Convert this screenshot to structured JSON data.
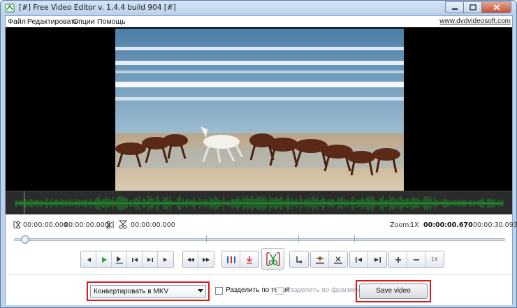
{
  "window": {
    "title": "[#] Free Video Editor v. 1.4.4 build 904 [#]"
  },
  "menu": {
    "items": [
      "Файл",
      "Редактировать",
      "Опции",
      "Помощь"
    ],
    "website": "www.dvdvideosoft.com"
  },
  "timeline": {
    "start_time": "00:00:00.000",
    "end_time": "00:00:00.000",
    "cut_time": "00:00:00.000",
    "zoom_label": "Zoom:",
    "zoom_value": "1X",
    "current_time": "00:00:00.670",
    "separator": "/",
    "total_time": "00:00:30.093"
  },
  "toolbar": {
    "zoom_level": "1X"
  },
  "bottom": {
    "format_select": "Конвертировать в MKV",
    "split_by_tags_label": "Разделить по тегам",
    "split_by_tags_checked": false,
    "split_by_fragments_label": "Разделить по фрагментам",
    "split_by_fragments_checked": false,
    "split_by_fragments_enabled": false,
    "save_button": "Save video"
  },
  "colors": {
    "waveform": "#1e8a2a",
    "highlight": "#e01818",
    "play_icon": "#2a9d3a",
    "cut_icon": "#1f8f2f"
  }
}
